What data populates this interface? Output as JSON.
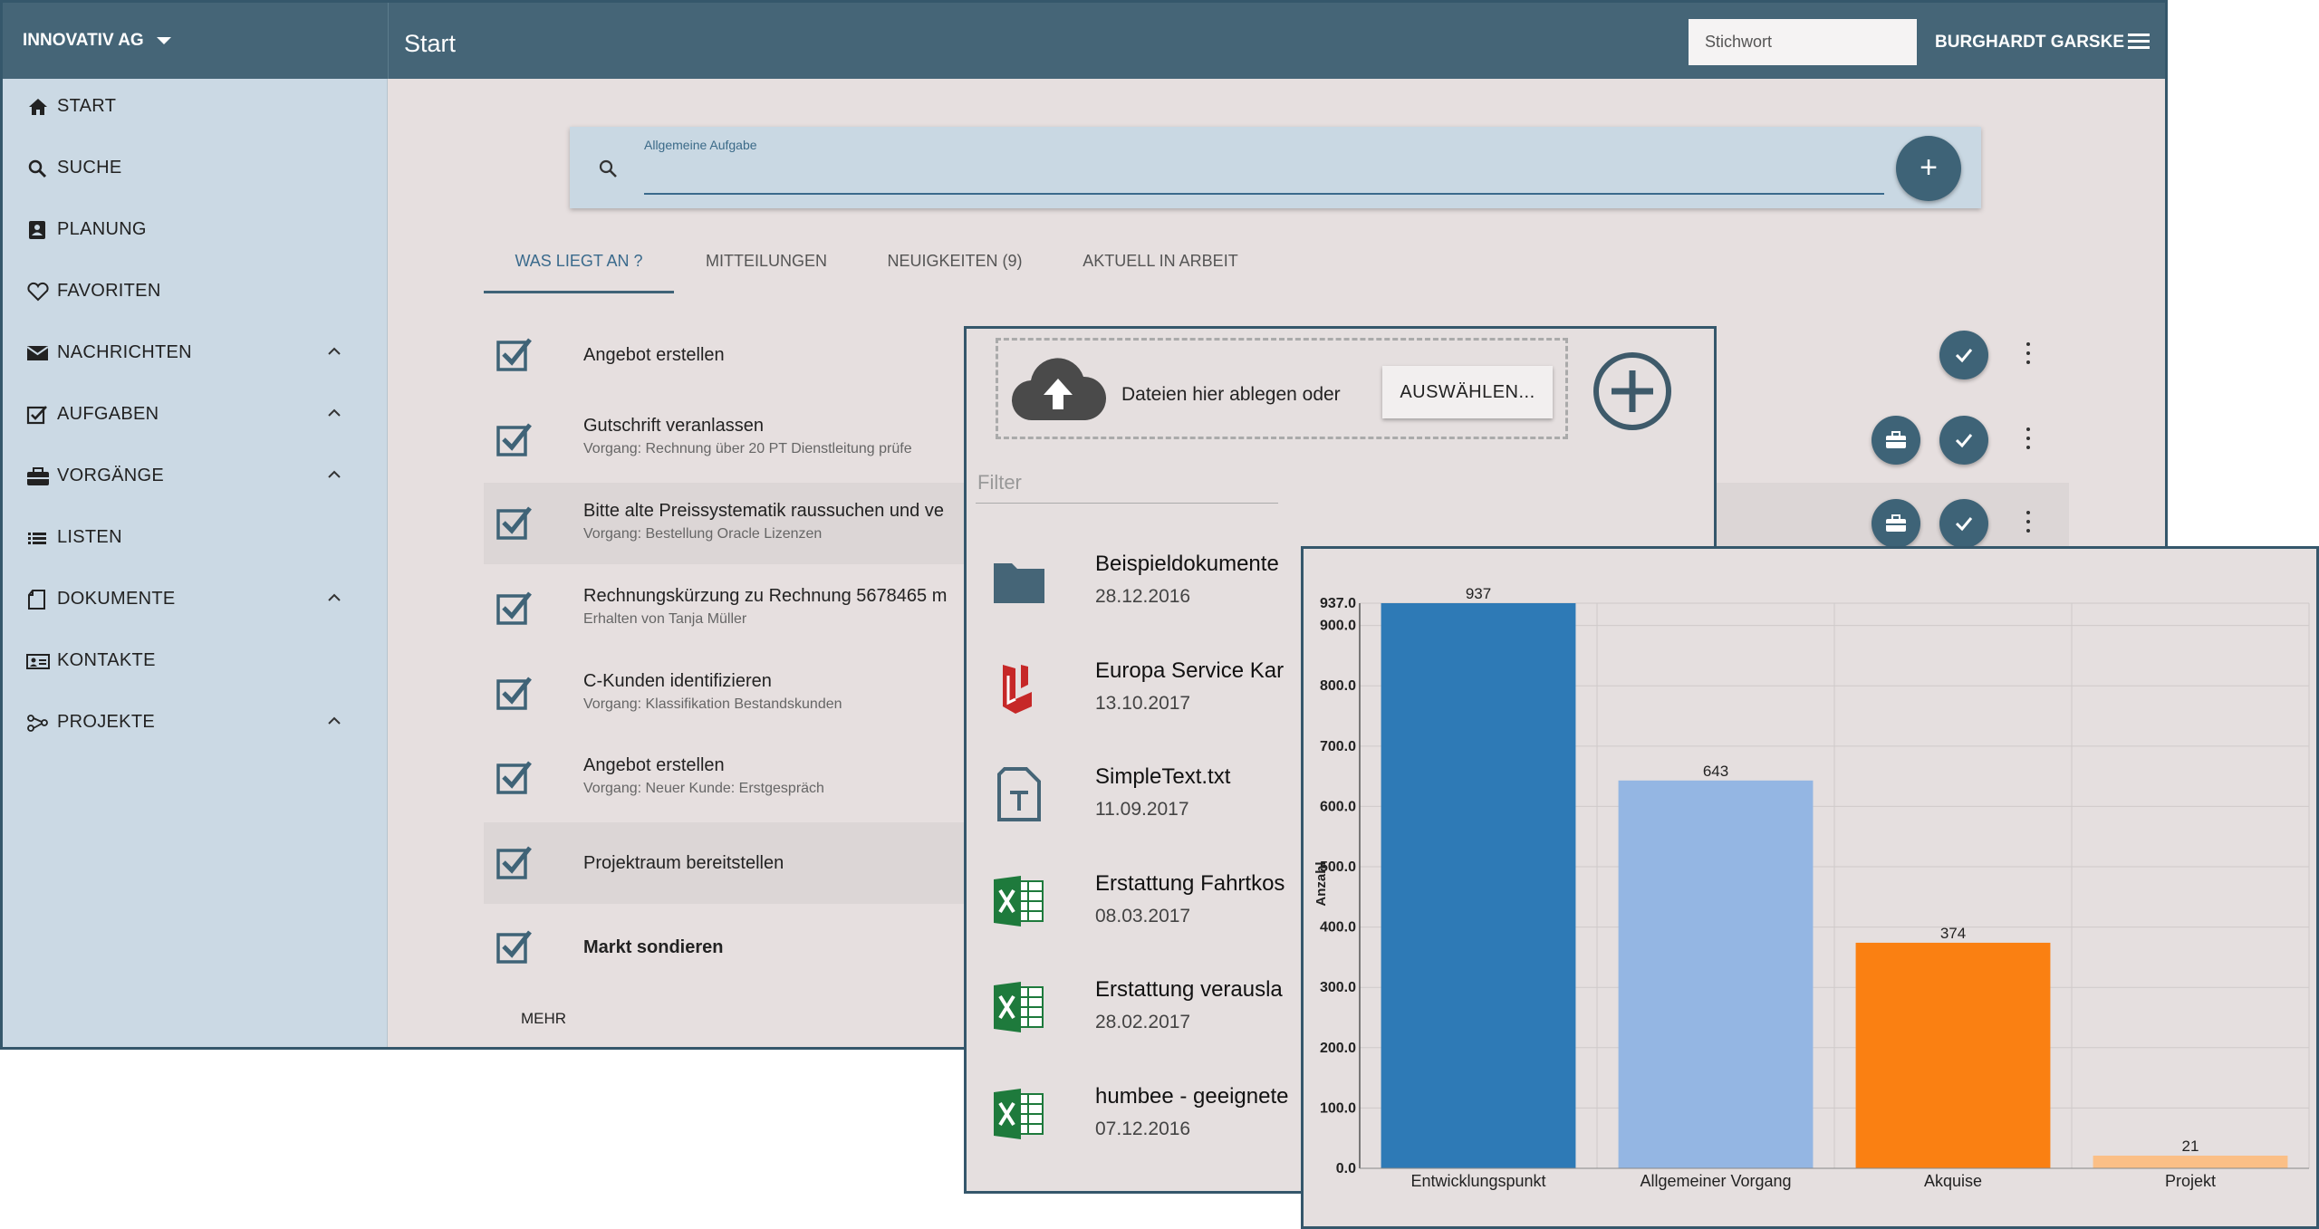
{
  "header": {
    "company": "INNOVATIV AG",
    "title": "Start",
    "search_placeholder": "Stichwort",
    "user": "BURGHARDT GARSKE"
  },
  "sidebar": {
    "items": [
      {
        "label": "START",
        "icon": "home-icon",
        "expandable": false
      },
      {
        "label": "SUCHE",
        "icon": "search-icon",
        "expandable": false
      },
      {
        "label": "PLANUNG",
        "icon": "planning-icon",
        "expandable": false
      },
      {
        "label": "FAVORITEN",
        "icon": "heart-icon",
        "expandable": false
      },
      {
        "label": "NACHRICHTEN",
        "icon": "mail-icon",
        "expandable": true
      },
      {
        "label": "AUFGABEN",
        "icon": "checkbox-icon",
        "expandable": true
      },
      {
        "label": "VORGÄNGE",
        "icon": "briefcase-icon",
        "expandable": true
      },
      {
        "label": "LISTEN",
        "icon": "list-icon",
        "expandable": false
      },
      {
        "label": "DOKUMENTE",
        "icon": "document-icon",
        "expandable": true
      },
      {
        "label": "KONTAKTE",
        "icon": "contact-card-icon",
        "expandable": false
      },
      {
        "label": "PROJEKTE",
        "icon": "project-icon",
        "expandable": true
      }
    ]
  },
  "task_input": {
    "label": "Allgemeine Aufgabe",
    "add_label": "+"
  },
  "tabs": [
    {
      "label": "WAS LIEGT AN ?",
      "active": true
    },
    {
      "label": "MITTEILUNGEN",
      "active": false
    },
    {
      "label": "NEUIGKEITEN (9)",
      "active": false
    },
    {
      "label": "AKTUELL IN ARBEIT",
      "active": false
    }
  ],
  "tasks": [
    {
      "title": "Angebot erstellen",
      "subtitle": "",
      "bold": false,
      "highlighted": false
    },
    {
      "title": "Gutschrift veranlassen",
      "subtitle": "Vorgang: Rechnung über 20 PT Dienstleitung prüfe",
      "bold": false,
      "highlighted": false
    },
    {
      "title": "Bitte alte Preissystematik raussuchen und ve",
      "subtitle": "Vorgang: Bestellung Oracle Lizenzen",
      "bold": false,
      "highlighted": true
    },
    {
      "title": "Rechnungskürzung zu Rechnung 5678465 m",
      "subtitle": "Erhalten von Tanja Müller",
      "bold": false,
      "highlighted": false
    },
    {
      "title": "C-Kunden identifizieren",
      "subtitle": "Vorgang: Klassifikation Bestandskunden",
      "bold": false,
      "highlighted": false
    },
    {
      "title": "Angebot erstellen",
      "subtitle": "Vorgang: Neuer Kunde: Erstgespräch",
      "bold": false,
      "highlighted": false
    },
    {
      "title": "Projektraum bereitstellen",
      "subtitle": "",
      "bold": false,
      "highlighted": true
    },
    {
      "title": "Markt sondieren",
      "subtitle": "",
      "bold": true,
      "highlighted": false
    }
  ],
  "more_label": "MEHR",
  "files_panel": {
    "drop_text": "Dateien hier ablegen oder",
    "select_label": "AUSWÄHLEN...",
    "filter_placeholder": "Filter",
    "files": [
      {
        "name": "Beispieldokumente",
        "date": "28.12.2016",
        "icon": "folder-icon"
      },
      {
        "name": "Europa Service Kar",
        "date": "13.10.2017",
        "icon": "pdf-icon"
      },
      {
        "name": "SimpleText.txt",
        "date": "11.09.2017",
        "icon": "text-file-icon"
      },
      {
        "name": "Erstattung Fahrtkos",
        "date": "08.03.2017",
        "icon": "excel-icon"
      },
      {
        "name": "Erstattung verausla",
        "date": "28.02.2017",
        "icon": "excel-icon"
      },
      {
        "name": "humbee - geeignete",
        "date": "07.12.2016",
        "icon": "excel-icon"
      }
    ]
  },
  "chart_data": {
    "type": "bar",
    "categories": [
      "Entwicklungspunkt",
      "Allgemeiner Vorgang",
      "Akquise",
      "Projekt"
    ],
    "values": [
      937,
      643,
      374,
      21
    ],
    "colors": [
      "#2e7ab6",
      "#94b6e3",
      "#fa8012",
      "#fbbf86"
    ],
    "ylabel": "Anzahl",
    "ylim": [
      0,
      937
    ],
    "yticks": [
      "0.0",
      "100.0",
      "200.0",
      "300.0",
      "400.0",
      "500.0",
      "600.0",
      "700.0",
      "800.0",
      "900.0",
      "937.0"
    ],
    "grid": true
  }
}
